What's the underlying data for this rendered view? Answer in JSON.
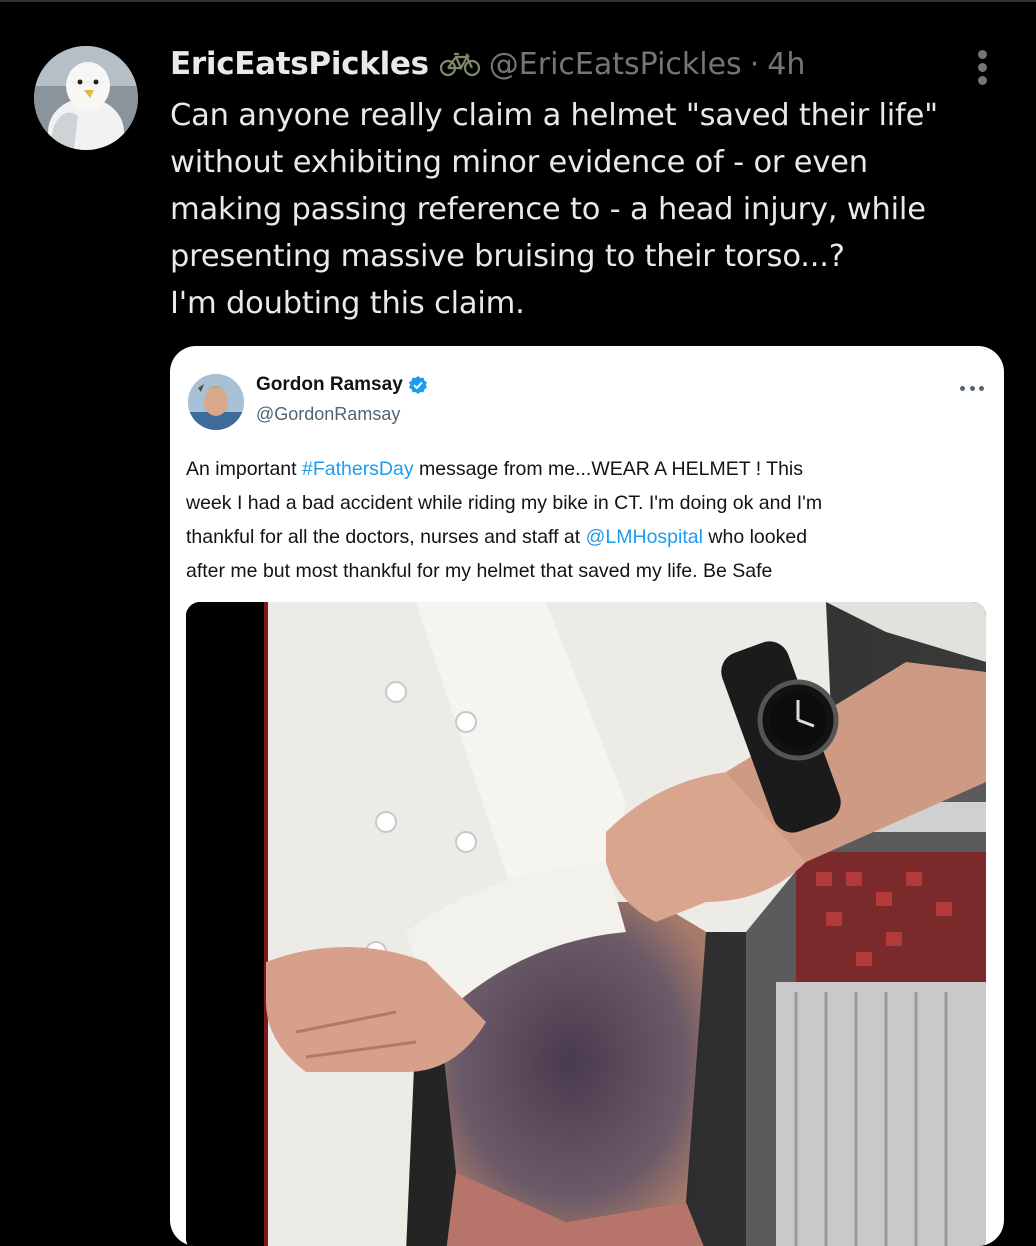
{
  "tweet": {
    "display_name": "EricEatsPickles",
    "handle": "@EricEatsPickles",
    "separator": "·",
    "time": "4h",
    "text_lines": [
      "Can anyone really claim a helmet \"saved their life\"",
      "without exhibiting minor evidence of - or even",
      "making passing reference to - a head injury, while",
      "presenting massive bruising to their torso...?",
      "I'm doubting this claim."
    ],
    "name_badge_icon": "bicycle-icon"
  },
  "quoted_tweet": {
    "display_name": "Gordon Ramsay",
    "handle": "@GordonRamsay",
    "verified_icon": "verified-badge-icon",
    "text": {
      "line1_a": "An important ",
      "line1_link": "#FathersDay",
      "line1_b": " message from me...WEAR A HELMET ! This",
      "line2": "week I had a bad accident while riding my bike in CT. I'm doing ok and I'm",
      "line3_a": "thankful for all the doctors, nurses and staff at ",
      "line3_link": "@LMHospital",
      "line3_b": " who looked",
      "line4": "after me but most thankful for my helmet that saved my life. Be Safe"
    }
  },
  "colors": {
    "background": "#000000",
    "text_primary": "#e7e9ea",
    "text_secondary": "#71767b",
    "link": "#1d9bf0",
    "verified": "#1d9bf0",
    "card_background": "#ffffff"
  }
}
